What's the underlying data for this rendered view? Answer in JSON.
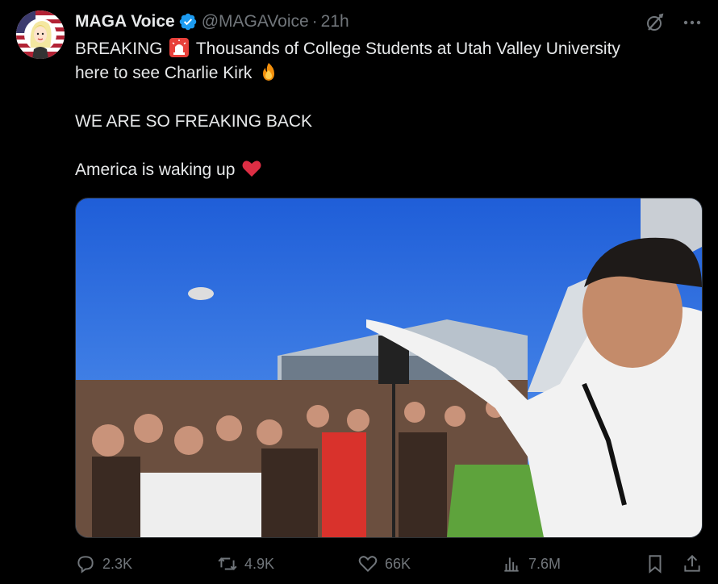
{
  "tweet": {
    "author_name": "MAGA Voice",
    "handle": "@MAGAVoice",
    "separator": "·",
    "time": "21h",
    "line1_a": "BREAKING",
    "line1_b": "Thousands of College Students at Utah Valley University",
    "line2": "here to see Charlie Kirk",
    "line3": "WE ARE SO FREAKING BACK",
    "line4": "America is waking up"
  },
  "stats": {
    "replies": "2.3K",
    "reposts": "4.9K",
    "likes": "66K",
    "views": "7.6M"
  },
  "colors": {
    "background": "#000000",
    "text": "#e7e9ea",
    "muted": "#71767b",
    "verified": "#1d9bf0"
  },
  "icons": [
    "grok-icon",
    "more-icon",
    "reply-icon",
    "repost-icon",
    "like-icon",
    "views-icon",
    "bookmark-icon",
    "share-icon",
    "verified-badge-icon"
  ]
}
